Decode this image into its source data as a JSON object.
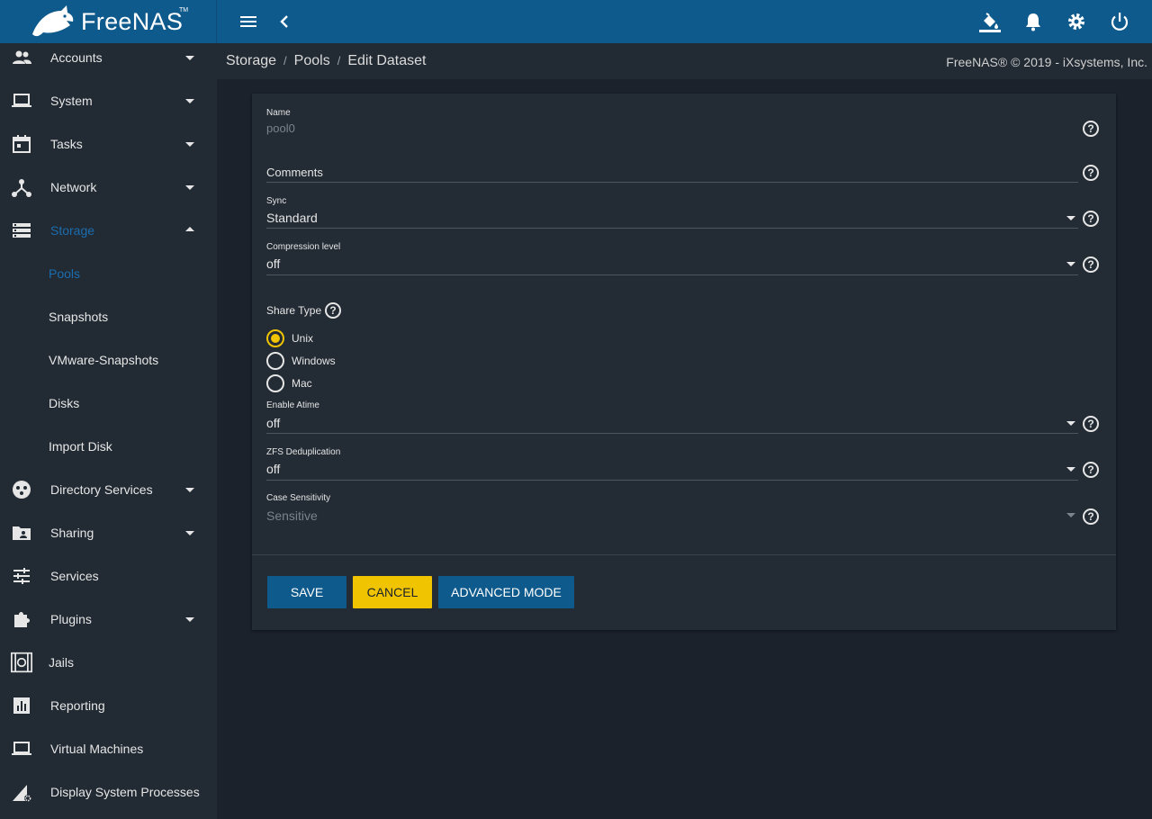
{
  "brand": {
    "name": "FreeNAS",
    "tm": "TM"
  },
  "topbar": {
    "icons": [
      "menu-icon",
      "chevron-left-icon",
      "paint-bucket-icon",
      "bell-icon",
      "gear-icon",
      "power-icon"
    ]
  },
  "sidebar": {
    "items": [
      {
        "label": "Accounts",
        "icon": "people-icon"
      },
      {
        "label": "System",
        "icon": "laptop-icon"
      },
      {
        "label": "Tasks",
        "icon": "calendar-icon"
      },
      {
        "label": "Network",
        "icon": "network-icon"
      },
      {
        "label": "Storage",
        "icon": "storage-icon"
      },
      {
        "label": "Directory Services",
        "icon": "directory-icon"
      },
      {
        "label": "Sharing",
        "icon": "folder-share-icon"
      },
      {
        "label": "Services",
        "icon": "sliders-icon"
      },
      {
        "label": "Plugins",
        "icon": "puzzle-icon"
      },
      {
        "label": "Jails",
        "icon": "jail-icon"
      },
      {
        "label": "Reporting",
        "icon": "chart-icon"
      },
      {
        "label": "Virtual Machines",
        "icon": "laptop-icon"
      },
      {
        "label": "Display System Processes",
        "icon": "processes-icon"
      }
    ],
    "storage_sub": [
      "Pools",
      "Snapshots",
      "VMware-Snapshots",
      "Disks",
      "Import Disk"
    ]
  },
  "breadcrumb": {
    "items": [
      "Storage",
      "Pools",
      "Edit Dataset"
    ],
    "separator": "/"
  },
  "copyright": "FreeNAS® © 2019 - iXsystems, Inc.",
  "form": {
    "name": {
      "label": "Name",
      "value": "pool0"
    },
    "comments": {
      "placeholder": "Comments"
    },
    "sync": {
      "label": "Sync",
      "value": "Standard"
    },
    "compression": {
      "label": "Compression level",
      "value": "off"
    },
    "share_type": {
      "label": "Share Type",
      "options": [
        "Unix",
        "Windows",
        "Mac"
      ],
      "selected": "Unix"
    },
    "atime": {
      "label": "Enable Atime",
      "value": "off"
    },
    "dedup": {
      "label": "ZFS Deduplication",
      "value": "off"
    },
    "case": {
      "label": "Case Sensitivity",
      "value": "Sensitive"
    },
    "help_glyph": "?"
  },
  "buttons": {
    "save": "SAVE",
    "cancel": "CANCEL",
    "advanced": "ADVANCED MODE"
  },
  "colors": {
    "primary": "#0f5a8c",
    "accent": "#f0c400",
    "background": "#1b222b",
    "panel": "#232b34",
    "active_link": "#1a6eb0"
  }
}
